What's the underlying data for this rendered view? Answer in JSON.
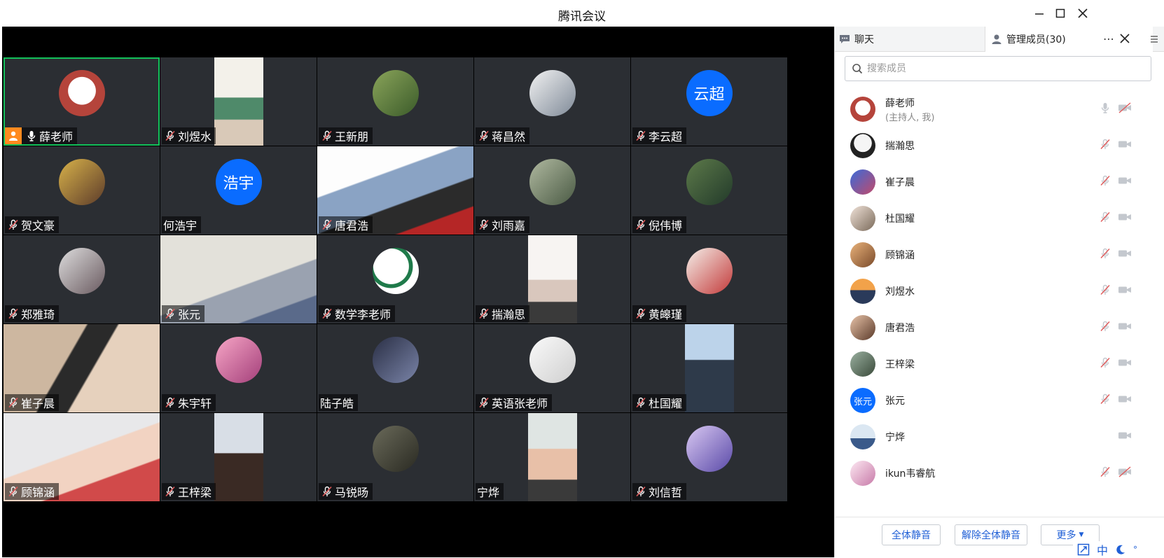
{
  "window": {
    "title": "腾讯会议"
  },
  "tiles": [
    {
      "name": "薛老师",
      "mic": "on",
      "host": true,
      "active": true
    },
    {
      "name": "刘煜水",
      "mic": "off"
    },
    {
      "name": "王新朋",
      "mic": "off"
    },
    {
      "name": "蒋昌然",
      "mic": "off"
    },
    {
      "name": "李云超",
      "mic": "off",
      "text_avatar": "云超"
    },
    {
      "name": "贺文豪",
      "mic": "off"
    },
    {
      "name": "何浩宇",
      "mic": "none",
      "text_avatar": "浩宇"
    },
    {
      "name": "唐君浩",
      "mic": "off"
    },
    {
      "name": "刘雨嘉",
      "mic": "off"
    },
    {
      "name": "倪伟博",
      "mic": "off"
    },
    {
      "name": "郑雅琦",
      "mic": "off"
    },
    {
      "name": "张元",
      "mic": "off"
    },
    {
      "name": "数学李老师",
      "mic": "off"
    },
    {
      "name": "揣瀚思",
      "mic": "off"
    },
    {
      "name": "黄皞瑾",
      "mic": "off"
    },
    {
      "name": "崔子晨",
      "mic": "off"
    },
    {
      "name": "朱宇轩",
      "mic": "off"
    },
    {
      "name": "陆子皓",
      "mic": "none"
    },
    {
      "name": "英语张老师",
      "mic": "off"
    },
    {
      "name": "杜国耀",
      "mic": "off"
    },
    {
      "name": "顾锦涵",
      "mic": "off"
    },
    {
      "name": "王梓梁",
      "mic": "off"
    },
    {
      "name": "马锐旸",
      "mic": "off"
    },
    {
      "name": "宁烨",
      "mic": "none"
    },
    {
      "name": "刘信哲",
      "mic": "off"
    }
  ],
  "panel": {
    "tab_chat": "聊天",
    "tab_members": "管理成员(30)",
    "search_placeholder": "搜索成员",
    "members": [
      {
        "name": "薛老师",
        "sub": "(主持人, 我)",
        "mic": "on",
        "cam": "off"
      },
      {
        "name": "揣瀚思",
        "mic": "off",
        "cam": "on"
      },
      {
        "name": "崔子晨",
        "mic": "off",
        "cam": "on"
      },
      {
        "name": "杜国耀",
        "mic": "off",
        "cam": "on"
      },
      {
        "name": "顾锦涵",
        "mic": "off",
        "cam": "on"
      },
      {
        "name": "刘煜水",
        "mic": "off",
        "cam": "on"
      },
      {
        "name": "唐君浩",
        "mic": "off",
        "cam": "on"
      },
      {
        "name": "王梓梁",
        "mic": "off",
        "cam": "on"
      },
      {
        "name": "张元",
        "mic": "off",
        "cam": "on",
        "text_avatar": "张元"
      },
      {
        "name": "宁烨",
        "mic": "none",
        "cam": "on"
      },
      {
        "name": "ikun韦睿航",
        "mic": "off",
        "cam": "off"
      }
    ],
    "buttons": {
      "mute_all": "全体静音",
      "unmute_all": "解除全体静音",
      "more": "更多"
    },
    "ime_label": "中"
  },
  "colors": {
    "accent": "#0a6cff",
    "active_border": "#12c05a",
    "host_badge": "#ff8a1f",
    "muted": "#e05a5a"
  }
}
